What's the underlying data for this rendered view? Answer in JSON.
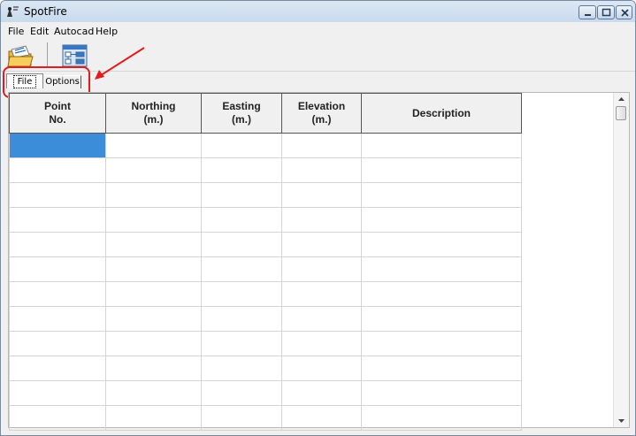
{
  "window": {
    "title": "SpotFire"
  },
  "menu": {
    "items": [
      "File",
      "Edit",
      "Autocad",
      "Help"
    ]
  },
  "toolbar": {
    "buttons": [
      "open-folder-icon",
      "layout-tree-icon"
    ]
  },
  "tabs": {
    "items": [
      "File",
      "Options"
    ],
    "selected": "File"
  },
  "annotation": {
    "highlight_color": "#e21c1c"
  },
  "grid": {
    "columns": [
      "Point\nNo.",
      "Northing\n(m.)",
      "Easting\n(m.)",
      "Elevation\n(m.)",
      "Description"
    ],
    "selection_color": "#3b8dd9"
  }
}
